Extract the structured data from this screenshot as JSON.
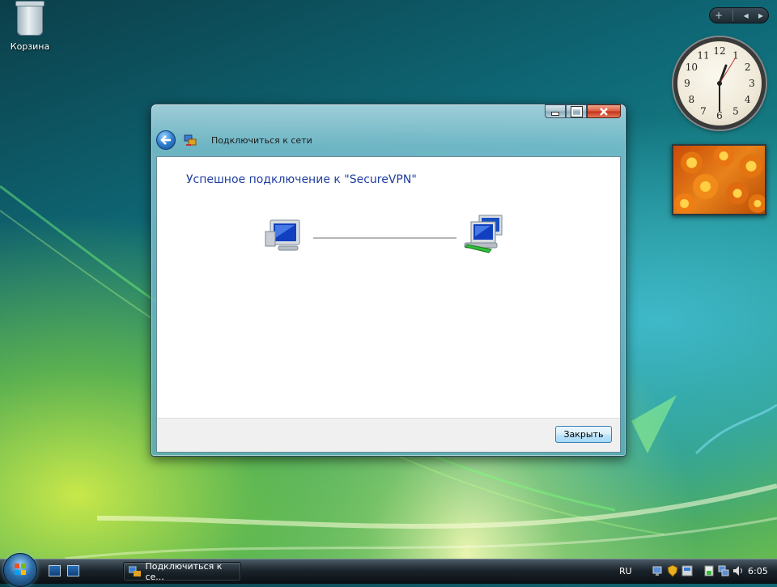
{
  "desktop": {
    "recycle_bin_label": "Корзина"
  },
  "sidebar": {
    "add_glyph": "+",
    "prev_glyph": "◂",
    "next_glyph": "▸"
  },
  "clock": {
    "numerals": [
      "12",
      "1",
      "2",
      "3",
      "4",
      "5",
      "6",
      "7",
      "8",
      "9",
      "10",
      "11"
    ]
  },
  "window": {
    "nav_title": "Подключиться к сети",
    "heading": "Успешное подключение к \"SecureVPN\"",
    "close_button_label": "Закрыть"
  },
  "taskbar": {
    "task_button_label": "Подключиться к се...",
    "language": "RU",
    "time": "6:05"
  }
}
